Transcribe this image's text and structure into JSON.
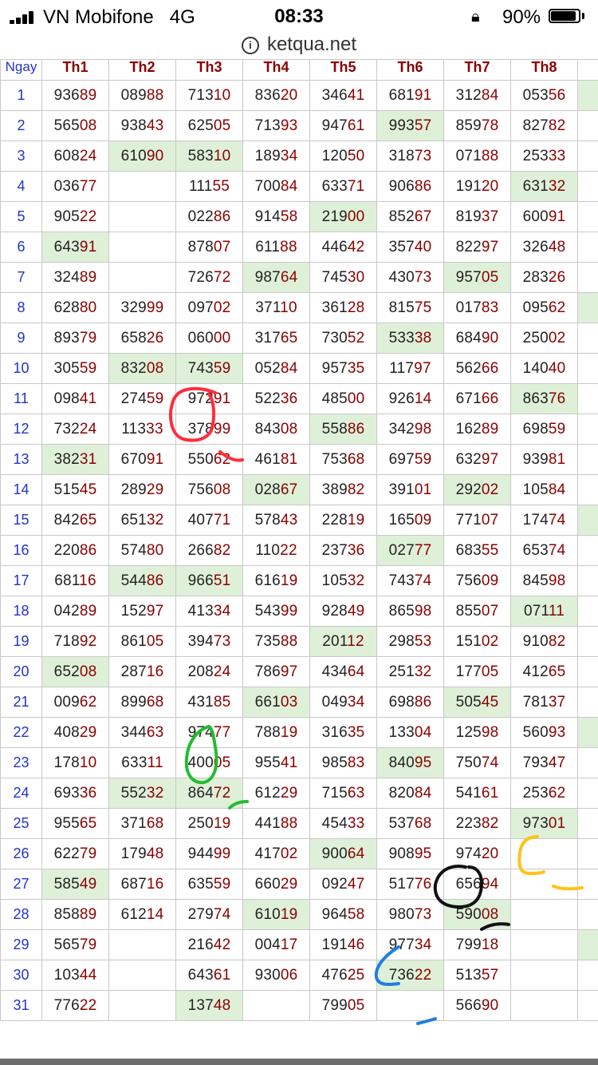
{
  "status_bar": {
    "carrier": "VN Mobifone",
    "network": "4G",
    "time": "08:33",
    "battery": "90%",
    "battery_level": 0.9
  },
  "address_bar": {
    "url": "ketqua.net"
  },
  "table": {
    "headers": [
      "Ngay",
      "Th1",
      "Th2",
      "Th3",
      "Th4",
      "Th5",
      "Th6",
      "Th7",
      "Th8"
    ],
    "rows": [
      {
        "day": "1",
        "cells": [
          "93689",
          "08988",
          "71310",
          "83620",
          "34641",
          "68191",
          "31284",
          "05356"
        ]
      },
      {
        "day": "2",
        "cells": [
          "56508",
          "93843",
          "62505",
          "71393",
          "94761",
          "99357",
          "85978",
          "82782"
        ]
      },
      {
        "day": "3",
        "cells": [
          "60824",
          "61090",
          "58310",
          "18934",
          "12050",
          "31873",
          "07188",
          "25333"
        ]
      },
      {
        "day": "4",
        "cells": [
          "03677",
          "",
          "11155",
          "70084",
          "63371",
          "90686",
          "19120",
          "63132"
        ]
      },
      {
        "day": "5",
        "cells": [
          "90522",
          "",
          "02286",
          "91458",
          "21900",
          "85267",
          "81937",
          "60091"
        ]
      },
      {
        "day": "6",
        "cells": [
          "64391",
          "",
          "87807",
          "61188",
          "44642",
          "35740",
          "82297",
          "32648"
        ]
      },
      {
        "day": "7",
        "cells": [
          "32489",
          "",
          "72672",
          "98764",
          "74530",
          "43073",
          "95705",
          "28326"
        ]
      },
      {
        "day": "8",
        "cells": [
          "62880",
          "32999",
          "09702",
          "37110",
          "36128",
          "81575",
          "01783",
          "09562"
        ]
      },
      {
        "day": "9",
        "cells": [
          "89379",
          "65826",
          "06000",
          "31765",
          "73052",
          "53338",
          "68490",
          "25002"
        ]
      },
      {
        "day": "10",
        "cells": [
          "30559",
          "83208",
          "74359",
          "05284",
          "95735",
          "11797",
          "56266",
          "14040"
        ]
      },
      {
        "day": "11",
        "cells": [
          "09841",
          "27459",
          "97291",
          "52236",
          "48500",
          "92614",
          "67166",
          "86376"
        ]
      },
      {
        "day": "12",
        "cells": [
          "73224",
          "11333",
          "37899",
          "84308",
          "55886",
          "34298",
          "16289",
          "69859"
        ]
      },
      {
        "day": "13",
        "cells": [
          "38231",
          "67091",
          "55062",
          "46181",
          "75368",
          "69759",
          "63297",
          "93981"
        ]
      },
      {
        "day": "14",
        "cells": [
          "51545",
          "28929",
          "75608",
          "02867",
          "38982",
          "39101",
          "29202",
          "10584"
        ]
      },
      {
        "day": "15",
        "cells": [
          "84265",
          "65132",
          "40771",
          "57843",
          "22819",
          "16509",
          "77107",
          "17474"
        ]
      },
      {
        "day": "16",
        "cells": [
          "22086",
          "57480",
          "26682",
          "11022",
          "23736",
          "02777",
          "68355",
          "65374"
        ]
      },
      {
        "day": "17",
        "cells": [
          "68116",
          "54486",
          "96651",
          "61619",
          "10532",
          "74374",
          "75609",
          "84598"
        ]
      },
      {
        "day": "18",
        "cells": [
          "04289",
          "15297",
          "41334",
          "54399",
          "92849",
          "86598",
          "85507",
          "07111"
        ]
      },
      {
        "day": "19",
        "cells": [
          "71892",
          "86105",
          "39473",
          "73588",
          "20112",
          "29853",
          "15102",
          "91082"
        ]
      },
      {
        "day": "20",
        "cells": [
          "65208",
          "28716",
          "20824",
          "78697",
          "43464",
          "25132",
          "17705",
          "41265"
        ]
      },
      {
        "day": "21",
        "cells": [
          "00962",
          "89968",
          "43185",
          "66103",
          "04934",
          "69886",
          "50545",
          "78137"
        ]
      },
      {
        "day": "22",
        "cells": [
          "40829",
          "34463",
          "97477",
          "78819",
          "31635",
          "13304",
          "12598",
          "56093"
        ]
      },
      {
        "day": "23",
        "cells": [
          "17810",
          "63311",
          "40005",
          "95541",
          "98583",
          "84095",
          "75074",
          "79347"
        ]
      },
      {
        "day": "24",
        "cells": [
          "69336",
          "55232",
          "86472",
          "61229",
          "71563",
          "82084",
          "54161",
          "25362"
        ]
      },
      {
        "day": "25",
        "cells": [
          "95565",
          "37168",
          "25019",
          "44188",
          "45433",
          "53768",
          "22382",
          "97301"
        ]
      },
      {
        "day": "26",
        "cells": [
          "62279",
          "17948",
          "94499",
          "41702",
          "90064",
          "90895",
          "97420",
          ""
        ]
      },
      {
        "day": "27",
        "cells": [
          "58549",
          "68716",
          "63559",
          "66029",
          "09247",
          "51776",
          "65694",
          ""
        ]
      },
      {
        "day": "28",
        "cells": [
          "85889",
          "61214",
          "27974",
          "61019",
          "96458",
          "98073",
          "59008",
          ""
        ]
      },
      {
        "day": "29",
        "cells": [
          "56579",
          "",
          "21642",
          "00417",
          "19146",
          "97734",
          "79918",
          ""
        ]
      },
      {
        "day": "30",
        "cells": [
          "10344",
          "",
          "64361",
          "93006",
          "47625",
          "73622",
          "51357",
          ""
        ]
      },
      {
        "day": "31",
        "cells": [
          "77622",
          "",
          "13748",
          "",
          "79905",
          "",
          "56690",
          ""
        ]
      }
    ],
    "highlighted_cells": [
      [
        0,
        8
      ],
      [
        1,
        5
      ],
      [
        2,
        1
      ],
      [
        2,
        2
      ],
      [
        3,
        7
      ],
      [
        4,
        4
      ],
      [
        5,
        0
      ],
      [
        6,
        3
      ],
      [
        6,
        6
      ],
      [
        7,
        8
      ],
      [
        8,
        5
      ],
      [
        9,
        1
      ],
      [
        9,
        2
      ],
      [
        10,
        7
      ],
      [
        11,
        4
      ],
      [
        12,
        0
      ],
      [
        13,
        3
      ],
      [
        13,
        6
      ],
      [
        14,
        8
      ],
      [
        15,
        5
      ],
      [
        16,
        1
      ],
      [
        16,
        2
      ],
      [
        17,
        7
      ],
      [
        18,
        4
      ],
      [
        19,
        0
      ],
      [
        20,
        3
      ],
      [
        20,
        6
      ],
      [
        21,
        8
      ],
      [
        22,
        5
      ],
      [
        23,
        1
      ],
      [
        23,
        2
      ],
      [
        24,
        7
      ],
      [
        25,
        4
      ],
      [
        26,
        0
      ],
      [
        27,
        3
      ],
      [
        27,
        6
      ],
      [
        28,
        8
      ],
      [
        29,
        5
      ],
      [
        30,
        2
      ]
    ],
    "colors": {
      "highlight": "#dff0d8",
      "header_text": "#8b0000",
      "tail_digits": "#8b0000",
      "day_text": "#2233cc"
    }
  },
  "annotations": [
    {
      "color": "#ff2d3c",
      "shape": "circle",
      "cell": "day 11 Th3"
    },
    {
      "color": "#22bb33",
      "shape": "circle",
      "cell": "day 22 Th3"
    },
    {
      "color": "#ffc21a",
      "shape": "circle",
      "cell": "day 25 Th8"
    },
    {
      "color": "#111111",
      "shape": "circle",
      "cell": "day 26 Th7"
    },
    {
      "color": "#1f7fe0",
      "shape": "circle",
      "cell": "day 29 Th6"
    }
  ]
}
